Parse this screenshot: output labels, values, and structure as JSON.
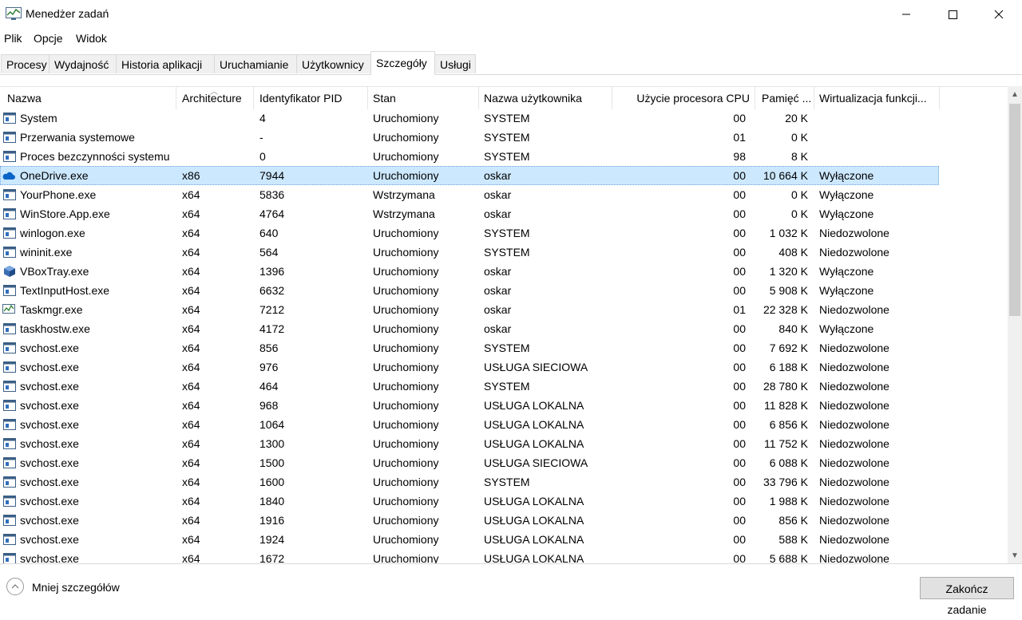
{
  "window": {
    "title": "Menedżer zadań"
  },
  "menu": [
    "Plik",
    "Opcje",
    "Widok"
  ],
  "tabs": [
    {
      "label": "Procesy"
    },
    {
      "label": "Wydajność"
    },
    {
      "label": "Historia aplikacji"
    },
    {
      "label": "Uruchamianie"
    },
    {
      "label": "Użytkownicy"
    },
    {
      "label": "Szczegóły",
      "active": true
    },
    {
      "label": "Usługi"
    }
  ],
  "columns": [
    "Nazwa",
    "Architecture",
    "Identyfikator PID",
    "Stan",
    "Nazwa użytkownika",
    "Użycie procesora CPU",
    "Pamięć ...",
    "Wirtualizacja funkcji..."
  ],
  "processes": [
    {
      "name": "System",
      "arch": "",
      "pid": "4",
      "status": "Uruchomiony",
      "user": "SYSTEM",
      "cpu": "00",
      "mem": "20 K",
      "virt": "",
      "icon": "system-icon"
    },
    {
      "name": "Przerwania systemowe",
      "arch": "",
      "pid": "-",
      "status": "Uruchomiony",
      "user": "SYSTEM",
      "cpu": "01",
      "mem": "0 K",
      "virt": "",
      "icon": "system-icon"
    },
    {
      "name": "Proces bezczynności systemu",
      "arch": "",
      "pid": "0",
      "status": "Uruchomiony",
      "user": "SYSTEM",
      "cpu": "98",
      "mem": "8 K",
      "virt": "",
      "icon": "system-icon"
    },
    {
      "name": "OneDrive.exe",
      "arch": "x86",
      "pid": "7944",
      "status": "Uruchomiony",
      "user": "oskar",
      "cpu": "00",
      "mem": "10 664 K",
      "virt": "Wyłączone",
      "icon": "onedrive-icon",
      "selected": true
    },
    {
      "name": "YourPhone.exe",
      "arch": "x64",
      "pid": "5836",
      "status": "Wstrzymana",
      "user": "oskar",
      "cpu": "00",
      "mem": "0 K",
      "virt": "Wyłączone",
      "icon": "app-window-icon"
    },
    {
      "name": "WinStore.App.exe",
      "arch": "x64",
      "pid": "4764",
      "status": "Wstrzymana",
      "user": "oskar",
      "cpu": "00",
      "mem": "0 K",
      "virt": "Wyłączone",
      "icon": "app-window-icon"
    },
    {
      "name": "winlogon.exe",
      "arch": "x64",
      "pid": "640",
      "status": "Uruchomiony",
      "user": "SYSTEM",
      "cpu": "00",
      "mem": "1 032 K",
      "virt": "Niedozwolone",
      "icon": "app-window-icon"
    },
    {
      "name": "wininit.exe",
      "arch": "x64",
      "pid": "564",
      "status": "Uruchomiony",
      "user": "SYSTEM",
      "cpu": "00",
      "mem": "408 K",
      "virt": "Niedozwolone",
      "icon": "app-window-icon"
    },
    {
      "name": "VBoxTray.exe",
      "arch": "x64",
      "pid": "1396",
      "status": "Uruchomiony",
      "user": "oskar",
      "cpu": "00",
      "mem": "1 320 K",
      "virt": "Wyłączone",
      "icon": "vbox-cube-icon"
    },
    {
      "name": "TextInputHost.exe",
      "arch": "x64",
      "pid": "6632",
      "status": "Uruchomiony",
      "user": "oskar",
      "cpu": "00",
      "mem": "5 908 K",
      "virt": "Wyłączone",
      "icon": "app-window-icon"
    },
    {
      "name": "Taskmgr.exe",
      "arch": "x64",
      "pid": "7212",
      "status": "Uruchomiony",
      "user": "oskar",
      "cpu": "01",
      "mem": "22 328 K",
      "virt": "Niedozwolone",
      "icon": "taskmgr-icon"
    },
    {
      "name": "taskhostw.exe",
      "arch": "x64",
      "pid": "4172",
      "status": "Uruchomiony",
      "user": "oskar",
      "cpu": "00",
      "mem": "840 K",
      "virt": "Wyłączone",
      "icon": "app-window-icon"
    },
    {
      "name": "svchost.exe",
      "arch": "x64",
      "pid": "856",
      "status": "Uruchomiony",
      "user": "SYSTEM",
      "cpu": "00",
      "mem": "7 692 K",
      "virt": "Niedozwolone",
      "icon": "app-window-icon"
    },
    {
      "name": "svchost.exe",
      "arch": "x64",
      "pid": "976",
      "status": "Uruchomiony",
      "user": "USŁUGA SIECIOWA",
      "cpu": "00",
      "mem": "6 188 K",
      "virt": "Niedozwolone",
      "icon": "app-window-icon"
    },
    {
      "name": "svchost.exe",
      "arch": "x64",
      "pid": "464",
      "status": "Uruchomiony",
      "user": "SYSTEM",
      "cpu": "00",
      "mem": "28 780 K",
      "virt": "Niedozwolone",
      "icon": "app-window-icon"
    },
    {
      "name": "svchost.exe",
      "arch": "x64",
      "pid": "968",
      "status": "Uruchomiony",
      "user": "USŁUGA LOKALNA",
      "cpu": "00",
      "mem": "11 828 K",
      "virt": "Niedozwolone",
      "icon": "app-window-icon"
    },
    {
      "name": "svchost.exe",
      "arch": "x64",
      "pid": "1064",
      "status": "Uruchomiony",
      "user": "USŁUGA LOKALNA",
      "cpu": "00",
      "mem": "6 856 K",
      "virt": "Niedozwolone",
      "icon": "app-window-icon"
    },
    {
      "name": "svchost.exe",
      "arch": "x64",
      "pid": "1300",
      "status": "Uruchomiony",
      "user": "USŁUGA LOKALNA",
      "cpu": "00",
      "mem": "11 752 K",
      "virt": "Niedozwolone",
      "icon": "app-window-icon"
    },
    {
      "name": "svchost.exe",
      "arch": "x64",
      "pid": "1500",
      "status": "Uruchomiony",
      "user": "USŁUGA SIECIOWA",
      "cpu": "00",
      "mem": "6 088 K",
      "virt": "Niedozwolone",
      "icon": "app-window-icon"
    },
    {
      "name": "svchost.exe",
      "arch": "x64",
      "pid": "1600",
      "status": "Uruchomiony",
      "user": "SYSTEM",
      "cpu": "00",
      "mem": "33 796 K",
      "virt": "Niedozwolone",
      "icon": "app-window-icon"
    },
    {
      "name": "svchost.exe",
      "arch": "x64",
      "pid": "1840",
      "status": "Uruchomiony",
      "user": "USŁUGA LOKALNA",
      "cpu": "00",
      "mem": "1 988 K",
      "virt": "Niedozwolone",
      "icon": "app-window-icon"
    },
    {
      "name": "svchost.exe",
      "arch": "x64",
      "pid": "1916",
      "status": "Uruchomiony",
      "user": "USŁUGA LOKALNA",
      "cpu": "00",
      "mem": "856 K",
      "virt": "Niedozwolone",
      "icon": "app-window-icon"
    },
    {
      "name": "svchost.exe",
      "arch": "x64",
      "pid": "1924",
      "status": "Uruchomiony",
      "user": "USŁUGA LOKALNA",
      "cpu": "00",
      "mem": "588 K",
      "virt": "Niedozwolone",
      "icon": "app-window-icon"
    },
    {
      "name": "svchost.exe",
      "arch": "x64",
      "pid": "1672",
      "status": "Uruchomiony",
      "user": "USŁUGA LOKALNA",
      "cpu": "00",
      "mem": "5 688 K",
      "virt": "Niedozwolone",
      "icon": "app-window-icon"
    }
  ],
  "footer": {
    "less_details": "Mniej szczegółów",
    "end_task": "Zakończ zadanie"
  },
  "colors": {
    "selection": "#cce8ff",
    "border": "#d9d9d9"
  }
}
